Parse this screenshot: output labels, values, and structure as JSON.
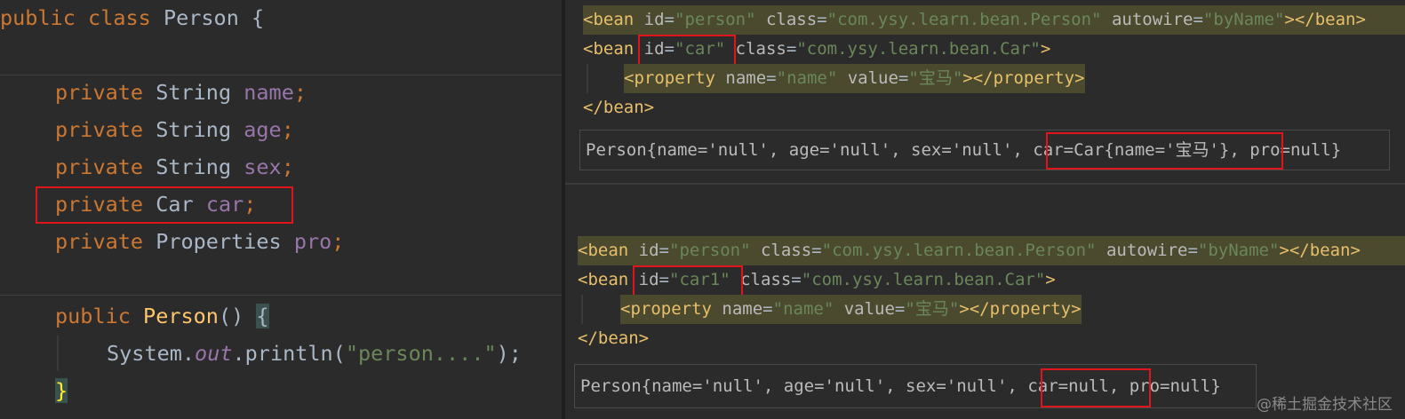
{
  "java": {
    "class_decl": {
      "kw1": "public",
      "kw2": "class",
      "name": "Person",
      "brace": "{"
    },
    "fields": [
      {
        "kw": "private",
        "type": "String",
        "name": "name",
        "semi": ";"
      },
      {
        "kw": "private",
        "type": "String",
        "name": "age",
        "semi": ";"
      },
      {
        "kw": "private",
        "type": "String",
        "name": "sex",
        "semi": ";"
      },
      {
        "kw": "private",
        "type": "Car",
        "name": "car",
        "semi": ";"
      },
      {
        "kw": "private",
        "type": "Properties",
        "name": "pro",
        "semi": ";"
      }
    ],
    "constructor": {
      "kw": "public",
      "name": "Person",
      "parens": "()",
      "brace": "{"
    },
    "body": {
      "obj": "System.",
      "field": "out",
      "call": ".println(",
      "str": "\"person....\"",
      "end": ");"
    },
    "close_brace": "}"
  },
  "xml_top": {
    "line1": {
      "tag_open": "<bean",
      "a1": "id",
      "v1": "\"person\"",
      "a2": "class",
      "v2": "\"com.ysy.learn.bean.Person\"",
      "a3": "autowire",
      "v3": "\"byName\"",
      "tag_close": "></bean>"
    },
    "line2": {
      "tag_open": "<bean",
      "a1": "id",
      "v1": "\"car\"",
      "a2": "class",
      "v2": "\"com.ysy.learn.bean.Car\"",
      "tag_close": ">"
    },
    "line3": {
      "tag_open": "<property",
      "a1": "name",
      "v1": "\"name\"",
      "a2": "value",
      "v2": "\"宝马\"",
      "tag_close": "></property>"
    },
    "line4": "</bean>",
    "console": {
      "p1": "Person{name='null', age='null', sex='null', ",
      "p2": "car=Car{name='宝马'},",
      "p3": " pro=null}"
    }
  },
  "xml_bottom": {
    "line1": {
      "tag_open": "<bean",
      "a1": "id",
      "v1": "\"person\"",
      "a2": "class",
      "v2": "\"com.ysy.learn.bean.Person\"",
      "a3": "autowire",
      "v3": "\"byName\"",
      "tag_close": "></bean>"
    },
    "line2": {
      "tag_open": "<bean",
      "a1": "id",
      "v1": "\"car1\"",
      "a2": "class",
      "v2": "\"com.ysy.learn.bean.Car\"",
      "tag_close": ">"
    },
    "line3": {
      "tag_open": "<property",
      "a1": "name",
      "v1": "\"name\"",
      "a2": "value",
      "v2": "\"宝马\"",
      "tag_close": "></property>"
    },
    "line4": "</bean>",
    "console": {
      "p1": "Person{name='null', age='null', sex='null', ",
      "p2": "car=null,",
      "p3": " pro=null}"
    }
  },
  "watermark": "@稀土掘金技术社区"
}
